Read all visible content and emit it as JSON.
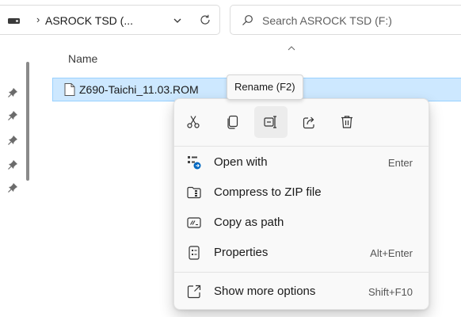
{
  "address_bar": {
    "breadcrumb_separator": "›",
    "location": "ASROCK TSD (...",
    "icons": [
      "drive-icon",
      "chevron-down-icon",
      "refresh-icon"
    ]
  },
  "search": {
    "placeholder": "Search ASROCK TSD (F:)",
    "value": ""
  },
  "file_list": {
    "column_header": "Name",
    "files": [
      {
        "name": "Z690-Taichi_11.03.ROM",
        "selected": true
      }
    ]
  },
  "tooltip": {
    "text": "Rename (F2)"
  },
  "context_menu": {
    "quick_actions": [
      {
        "name": "Cut",
        "icon": "cut-icon"
      },
      {
        "name": "Copy",
        "icon": "copy-icon"
      },
      {
        "name": "Rename",
        "icon": "rename-icon",
        "hovered": true
      },
      {
        "name": "Share",
        "icon": "share-icon"
      },
      {
        "name": "Delete",
        "icon": "trash-icon"
      }
    ],
    "items": [
      {
        "label": "Open with",
        "shortcut": "Enter",
        "icon": "open-with-icon"
      },
      {
        "label": "Compress to ZIP file",
        "shortcut": "",
        "icon": "zip-icon"
      },
      {
        "label": "Copy as path",
        "shortcut": "",
        "icon": "copy-path-icon"
      },
      {
        "label": "Properties",
        "shortcut": "Alt+Enter",
        "icon": "properties-icon"
      },
      {
        "label": "Show more options",
        "shortcut": "Shift+F10",
        "icon": "show-more-icon"
      }
    ]
  },
  "colors": {
    "selection_fill": "#cde8ff",
    "selection_border": "#99d1ff",
    "menu_background": "#f9f9f9",
    "accent_blue": "#0067c0"
  }
}
